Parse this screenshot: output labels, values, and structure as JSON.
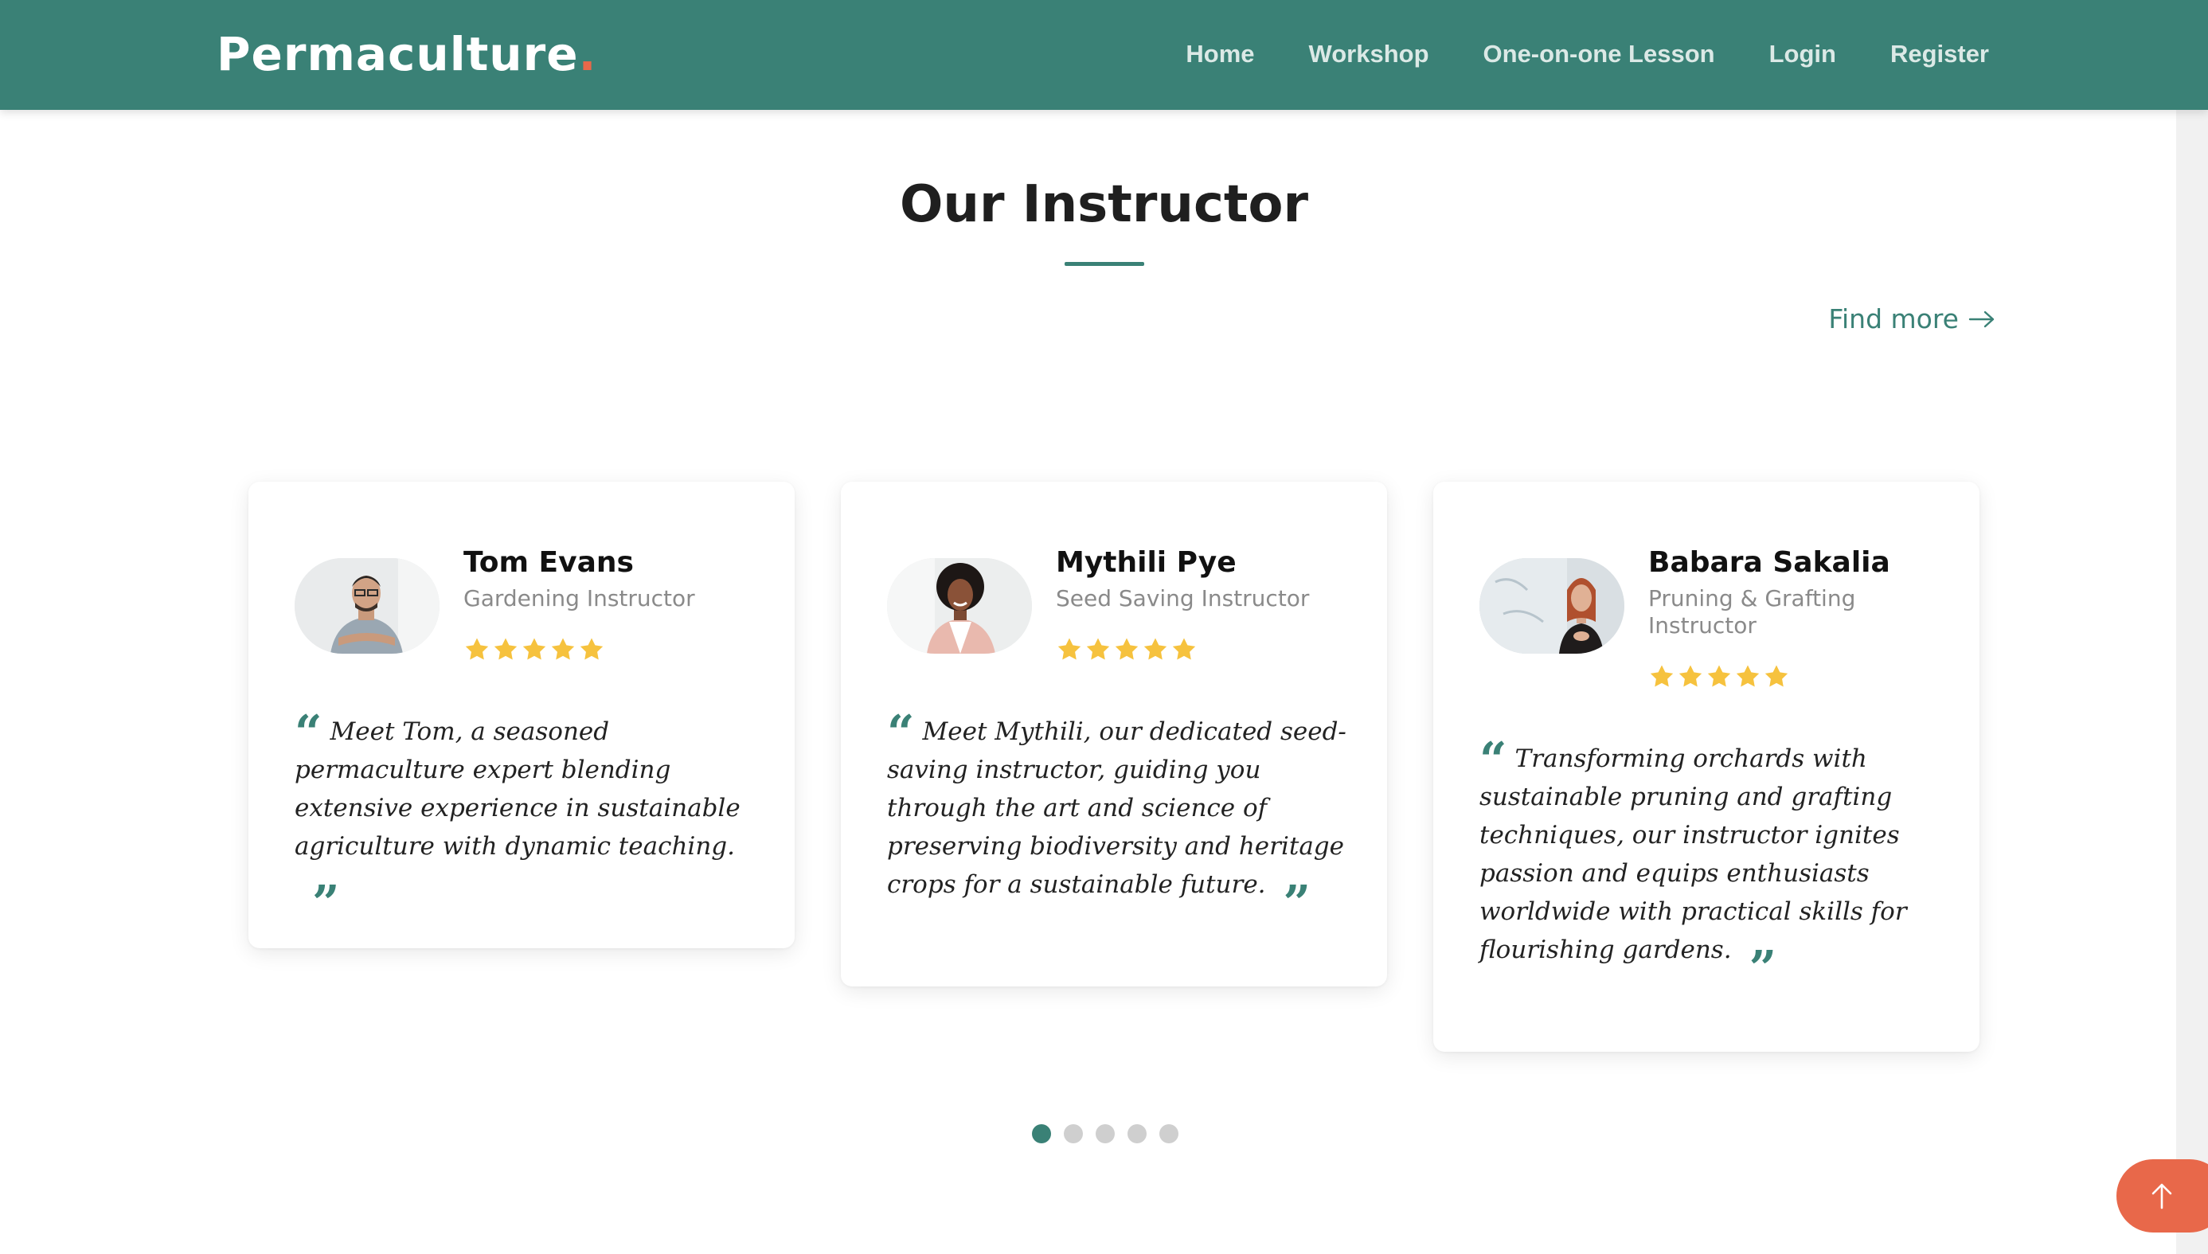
{
  "header": {
    "logo_text": "Permaculture",
    "logo_dot": ".",
    "nav": [
      "Home",
      "Workshop",
      "One-on-one Lesson",
      "Login",
      "Register"
    ]
  },
  "section": {
    "title": "Our Instructor",
    "find_more": "Find more"
  },
  "instructors": [
    {
      "name": "Tom Evans",
      "role": "Gardening Instructor",
      "rating": 5,
      "quote": "Meet Tom, a seasoned permaculture expert blending extensive experience in sustainable agriculture with dynamic teaching."
    },
    {
      "name": "Mythili Pye",
      "role": "Seed Saving Instructor",
      "rating": 5,
      "quote": "Meet Mythili, our dedicated seed-saving instructor, guiding you through the art and science of preserving biodiversity and heritage crops for a sustainable future."
    },
    {
      "name": "Babara Sakalia",
      "role": "Pruning & Grafting Instructor",
      "rating": 5,
      "quote": "Transforming orchards with sustainable pruning and grafting techniques, our instructor ignites passion and equips enthusiasts worldwide with practical skills for flourishing gardens."
    }
  ],
  "carousel": {
    "total_pages": 5,
    "active_page": 1
  },
  "icons": {
    "find_more": "arrow-right-icon",
    "quote_open": "quote-open-icon",
    "quote_close": "quote-close-icon",
    "rating_star": "star-icon",
    "back_to_top": "arrow-up-icon"
  },
  "colors": {
    "brand": "#3a8176",
    "accent": "#e8684a",
    "star": "#f6c23e",
    "dot_inactive": "#cfcfcf"
  }
}
